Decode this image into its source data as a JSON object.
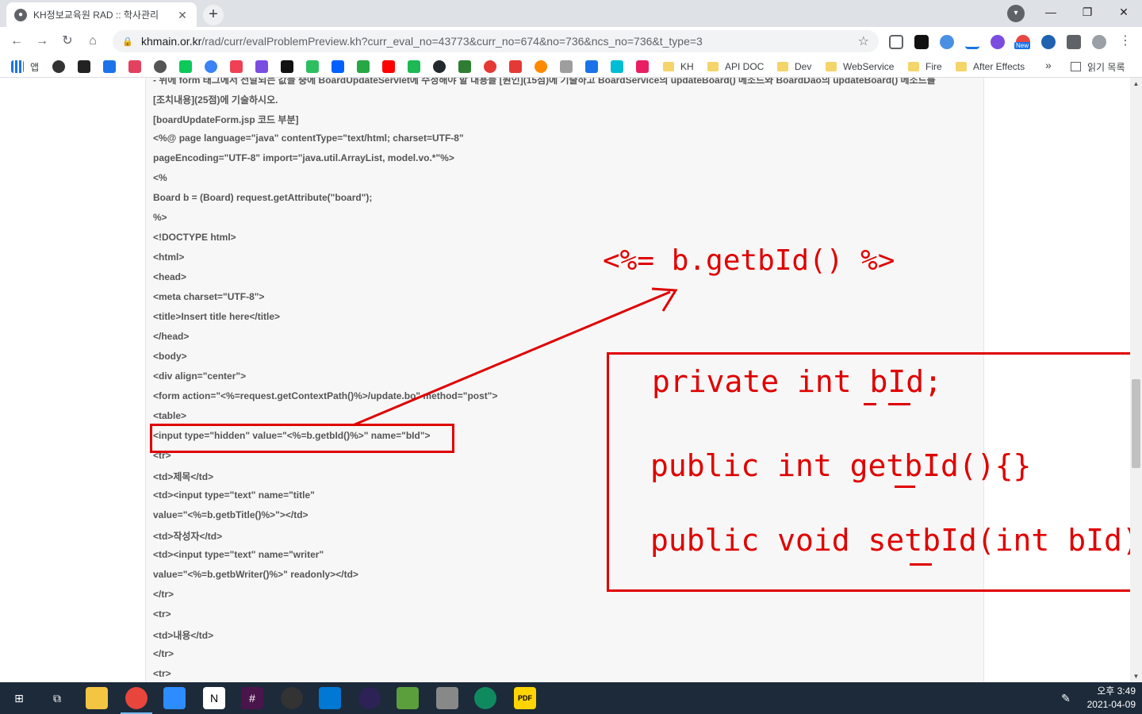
{
  "browser": {
    "tab_title": "KH정보교육원 RAD :: 학사관리",
    "tab_close": "✕",
    "new_tab": "+",
    "window": {
      "minimize": "—",
      "maximize": "❐",
      "close": "✕"
    },
    "url_host": "khmain.or.kr",
    "url_path": "/rad/curr/evalProblemPreview.kh?curr_eval_no=43773&curr_no=674&no=736&ncs_no=736&t_type=3",
    "extension_badge": "New"
  },
  "bookmarks": {
    "apps_label": "앱",
    "folders": [
      "KH",
      "API DOC",
      "Dev",
      "WebService",
      "Fire",
      "After Effects"
    ],
    "overflow": "»",
    "reading_list": "읽기 목록"
  },
  "content": {
    "lines": [
      "- 위에 form 태그에서 전달되는 값들 중에 BoardUpdateServlet에 수정해야 할 내용들 [원인](15점)에 기술하고 BoardService의 updateBoard() 메소드와 BoardDao의 updateBoard() 메소드를",
      "[조치내용](25점)에 기술하시오.",
      "[boardUpdateForm.jsp 코드 부분]",
      "<%@ page language=\"java\" contentType=\"text/html; charset=UTF-8\"",
      "pageEncoding=\"UTF-8\" import=\"java.util.ArrayList, model.vo.*\"%>",
      "<%",
      "Board b = (Board) request.getAttribute(\"board\");",
      "%>",
      "<!DOCTYPE html>",
      "<html>",
      "<head>",
      "<meta charset=\"UTF-8\">",
      "<title>Insert title here</title>",
      "</head>",
      "<body>",
      "<div align=\"center\">",
      "<form action=\"<%=request.getContextPath()%>/update.bo\" method=\"post\">",
      "<table>",
      "<input type=\"hidden\" value=\"<%=b.getbId()%>\" name=\"bId\">",
      "<tr>",
      "<td>제목</td>",
      "<td><input type=\"text\" name=\"title\"",
      "value=\"<%=b.getbTitle()%>\"></td>",
      "<td>작성자</td>",
      "<td><input type=\"text\" name=\"writer\"",
      "value=\"<%=b.getbWriter()%>\" readonly></td>",
      "</tr>",
      "<tr>",
      "<td>내용</td>",
      "</tr>",
      "<tr>"
    ]
  },
  "annotations": {
    "expression": "<%= b.getbId() %>",
    "code_lines": [
      "private int bId;",
      "public int getbId(){}",
      "public void setbId(int bId){"
    ],
    "color": "#e00000"
  },
  "taskbar": {
    "time": "오후 3:49",
    "date": "2021-04-09"
  }
}
